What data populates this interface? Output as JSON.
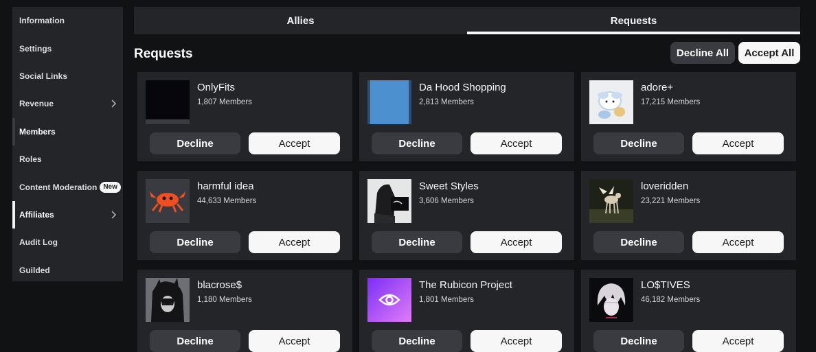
{
  "sidebar": {
    "items": [
      {
        "label": "Information"
      },
      {
        "label": "Settings"
      },
      {
        "label": "Social Links"
      },
      {
        "label": "Revenue"
      },
      {
        "label": "Members"
      },
      {
        "label": "Roles"
      },
      {
        "label": "Content Moderation",
        "badge": "New"
      },
      {
        "label": "Affiliates"
      },
      {
        "label": "Audit Log"
      },
      {
        "label": "Guilded"
      }
    ]
  },
  "tabs": [
    {
      "label": "Allies"
    },
    {
      "label": "Requests"
    }
  ],
  "section": {
    "title": "Requests",
    "decline_all": "Decline All",
    "accept_all": "Accept All"
  },
  "requests": [
    {
      "name": "OnlyFits",
      "members": "1,807 Members",
      "decline": "Decline",
      "accept": "Accept"
    },
    {
      "name": "Da Hood Shopping",
      "members": "2,813 Members",
      "decline": "Decline",
      "accept": "Accept"
    },
    {
      "name": "adore+",
      "members": "17,215 Members",
      "decline": "Decline",
      "accept": "Accept"
    },
    {
      "name": "harmful idea",
      "members": "44,633 Members",
      "decline": "Decline",
      "accept": "Accept"
    },
    {
      "name": "Sweet Styles",
      "members": "3,606 Members",
      "decline": "Decline",
      "accept": "Accept"
    },
    {
      "name": "loveridden",
      "members": "23,221 Members",
      "decline": "Decline",
      "accept": "Accept"
    },
    {
      "name": "blacrose$",
      "members": "1,180 Members",
      "decline": "Decline",
      "accept": "Accept"
    },
    {
      "name": "The Rubicon Project",
      "members": "1,801 Members",
      "decline": "Decline",
      "accept": "Accept"
    },
    {
      "name": "LO$TIVES",
      "members": "46,182 Members",
      "decline": "Decline",
      "accept": "Accept"
    }
  ]
}
